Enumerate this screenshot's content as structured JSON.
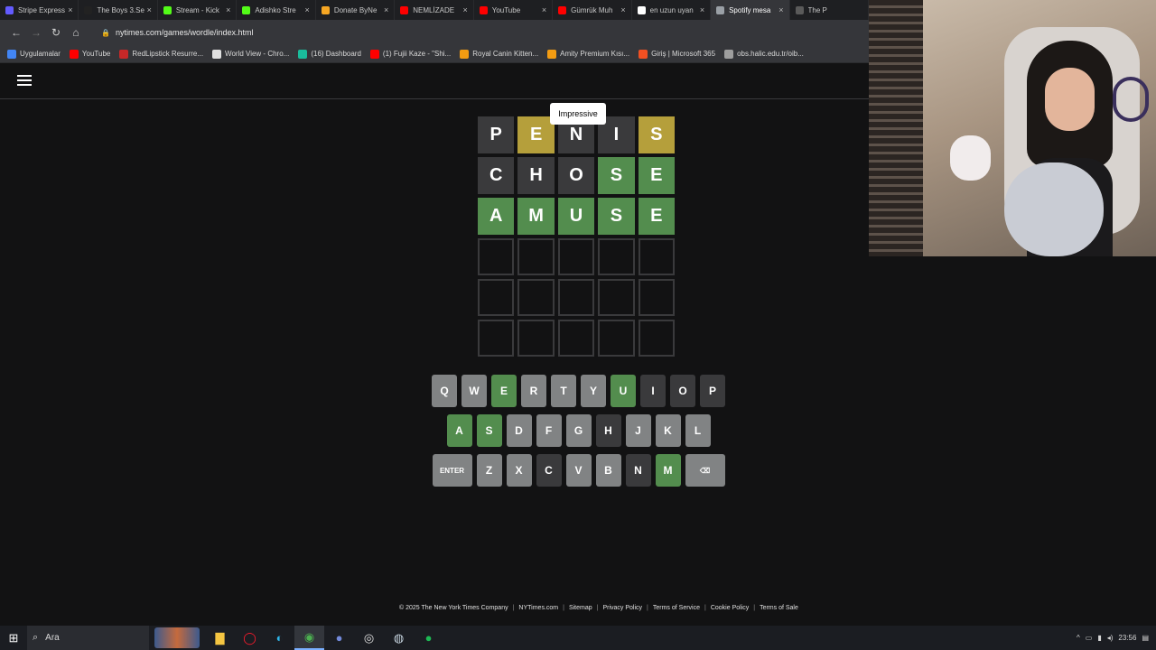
{
  "browser": {
    "tabs": [
      {
        "label": "Stripe Express",
        "color": "#635bff"
      },
      {
        "label": "The Boys 3.Se",
        "color": "#222222"
      },
      {
        "label": "Stream - Kick",
        "color": "#53fc18"
      },
      {
        "label": "Adishko Stre",
        "color": "#53fc18"
      },
      {
        "label": "Donate ByNe",
        "color": "#f5a623"
      },
      {
        "label": "NEMLİZADE",
        "color": "#ff0000"
      },
      {
        "label": "YouTube",
        "color": "#ff0000"
      },
      {
        "label": "Gümrük Muh",
        "color": "#ff0000"
      },
      {
        "label": "en uzun uyan",
        "color": "#ffffff"
      },
      {
        "label": "Spotify mesa",
        "color": "#9aa0a6"
      },
      {
        "label": "The P",
        "color": "#5a5a5a"
      }
    ],
    "close_glyph": "×",
    "url": "nytimes.com/games/wordle/index.html",
    "bookmarks": [
      {
        "label": "Uygulamalar",
        "color": "#4285f4"
      },
      {
        "label": "YouTube",
        "color": "#ff0000"
      },
      {
        "label": "RedLipstick Resurre...",
        "color": "#c62828"
      },
      {
        "label": "World View - Chro...",
        "color": "#e0e0e0"
      },
      {
        "label": "(16) Dashboard",
        "color": "#1abc9c"
      },
      {
        "label": "(1) Fujii Kaze - \"Shi...",
        "color": "#ff0000"
      },
      {
        "label": "Royal Canin Kitten...",
        "color": "#f39c12"
      },
      {
        "label": "Amity Premium Kısı...",
        "color": "#f39c12"
      },
      {
        "label": "Giriş | Microsoft 365",
        "color": "#f25022"
      },
      {
        "label": "obs.halic.edu.tr/oib...",
        "color": "#9e9e9e"
      }
    ]
  },
  "wordle": {
    "toast": "Impressive",
    "board": [
      [
        {
          "l": "P",
          "s": "absent"
        },
        {
          "l": "E",
          "s": "present"
        },
        {
          "l": "N",
          "s": "absent"
        },
        {
          "l": "I",
          "s": "absent"
        },
        {
          "l": "S",
          "s": "present"
        }
      ],
      [
        {
          "l": "C",
          "s": "absent"
        },
        {
          "l": "H",
          "s": "absent"
        },
        {
          "l": "O",
          "s": "absent"
        },
        {
          "l": "S",
          "s": "correct"
        },
        {
          "l": "E",
          "s": "correct"
        }
      ],
      [
        {
          "l": "A",
          "s": "correct"
        },
        {
          "l": "M",
          "s": "correct"
        },
        {
          "l": "U",
          "s": "correct"
        },
        {
          "l": "S",
          "s": "correct"
        },
        {
          "l": "E",
          "s": "correct"
        }
      ],
      [
        {
          "l": "",
          "s": "empty"
        },
        {
          "l": "",
          "s": "empty"
        },
        {
          "l": "",
          "s": "empty"
        },
        {
          "l": "",
          "s": "empty"
        },
        {
          "l": "",
          "s": "empty"
        }
      ],
      [
        {
          "l": "",
          "s": "empty"
        },
        {
          "l": "",
          "s": "empty"
        },
        {
          "l": "",
          "s": "empty"
        },
        {
          "l": "",
          "s": "empty"
        },
        {
          "l": "",
          "s": "empty"
        }
      ],
      [
        {
          "l": "",
          "s": "empty"
        },
        {
          "l": "",
          "s": "empty"
        },
        {
          "l": "",
          "s": "empty"
        },
        {
          "l": "",
          "s": "empty"
        },
        {
          "l": "",
          "s": "empty"
        }
      ]
    ],
    "keyboard": [
      [
        {
          "k": "Q",
          "s": "unused"
        },
        {
          "k": "W",
          "s": "unused"
        },
        {
          "k": "E",
          "s": "correct"
        },
        {
          "k": "R",
          "s": "unused"
        },
        {
          "k": "T",
          "s": "unused"
        },
        {
          "k": "Y",
          "s": "unused"
        },
        {
          "k": "U",
          "s": "correct"
        },
        {
          "k": "I",
          "s": "absent"
        },
        {
          "k": "O",
          "s": "absent"
        },
        {
          "k": "P",
          "s": "absent"
        }
      ],
      [
        {
          "k": "A",
          "s": "correct"
        },
        {
          "k": "S",
          "s": "correct"
        },
        {
          "k": "D",
          "s": "unused"
        },
        {
          "k": "F",
          "s": "unused"
        },
        {
          "k": "G",
          "s": "unused"
        },
        {
          "k": "H",
          "s": "absent"
        },
        {
          "k": "J",
          "s": "unused"
        },
        {
          "k": "K",
          "s": "unused"
        },
        {
          "k": "L",
          "s": "unused"
        }
      ],
      [
        {
          "k": "ENTER",
          "s": "unused",
          "wide": true
        },
        {
          "k": "Z",
          "s": "unused"
        },
        {
          "k": "X",
          "s": "unused"
        },
        {
          "k": "C",
          "s": "absent"
        },
        {
          "k": "V",
          "s": "unused"
        },
        {
          "k": "B",
          "s": "unused"
        },
        {
          "k": "N",
          "s": "absent"
        },
        {
          "k": "M",
          "s": "correct"
        },
        {
          "k": "⌫",
          "s": "unused",
          "wide": true
        }
      ]
    ],
    "footer": [
      "© 2025 The New York Times Company",
      "NYTimes.com",
      "Sitemap",
      "Privacy Policy",
      "Terms of Service",
      "Cookie Policy",
      "Terms of Sale"
    ]
  },
  "taskbar": {
    "search_label": "Ara",
    "clock": "23:56"
  },
  "colors": {
    "correct": "#538d4e",
    "present": "#b59f3b",
    "absent": "#3a3a3c"
  }
}
